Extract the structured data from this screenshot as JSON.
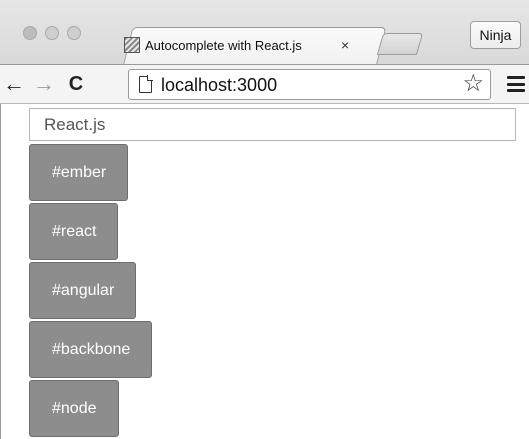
{
  "browser": {
    "tab": {
      "title": "Autocomplete with React.js",
      "close_glyph": "×",
      "favicon": "page-favicon-icon"
    },
    "profile_button_label": "Ninja",
    "toolbar": {
      "back_glyph": "←",
      "forward_glyph": "→",
      "reload_glyph": "C",
      "url": "localhost:3000",
      "star_glyph": "☆"
    }
  },
  "page": {
    "search": {
      "value": "React.js",
      "placeholder": "React.js"
    },
    "suggestions": [
      {
        "label": "#ember"
      },
      {
        "label": "#react"
      },
      {
        "label": "#angular"
      },
      {
        "label": "#backbone"
      },
      {
        "label": "#node"
      }
    ]
  },
  "colors": {
    "suggestion_bg": "#8d8d8d",
    "suggestion_text": "#ffffff",
    "chrome_bg": "#dedede"
  }
}
